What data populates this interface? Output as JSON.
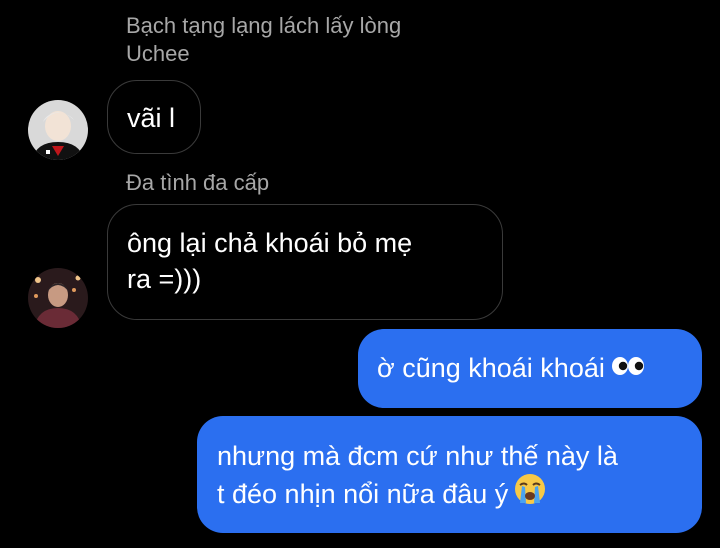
{
  "messages": [
    {
      "sender": "Bạch tạng lạng lách lấy lòng Uchee",
      "sender_lines": [
        "Bạch tạng lạng lách lấy lòng",
        "Uchee"
      ],
      "text_lines": [
        "vãi l"
      ],
      "avatar_icon": "avatar-photo-icon"
    },
    {
      "sender": "Đa tình đa cấp",
      "text_lines": [
        "ông lại chả khoái bỏ mẹ",
        "ra =)))"
      ],
      "avatar_icon": "avatar-photo-icon"
    },
    {
      "text_lines": [
        "ờ cũng khoái khoái"
      ],
      "emoji": "eyes-emoji-icon"
    },
    {
      "text_lines": [
        "nhưng mà đcm cứ như thế này là",
        "t đéo nhịn nổi nữa đâu ý"
      ],
      "emoji": "loudly-crying-emoji-icon"
    }
  ],
  "colors": {
    "background": "#000000",
    "sender_name": "#a7a7a7",
    "incoming_border": "#3a3a3a",
    "outgoing_bubble": "#2b6ff0",
    "text": "#ffffff"
  }
}
